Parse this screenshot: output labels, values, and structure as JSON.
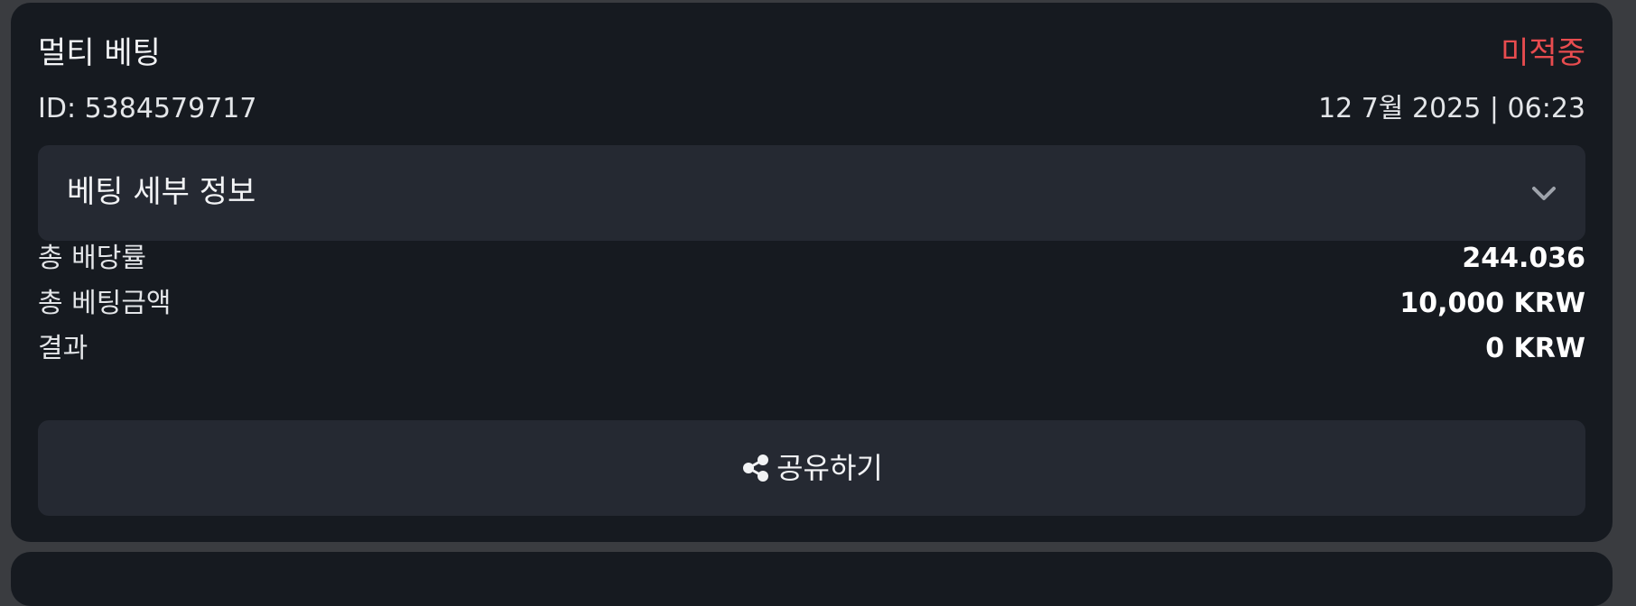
{
  "bet": {
    "title": "멀티 베팅",
    "status": "미적중",
    "id_text": "ID: 5384579717",
    "datetime": "12 7월 2025 | 06:23"
  },
  "details": {
    "label": "베팅 세부 정보"
  },
  "summary": {
    "rows": [
      {
        "label": "총 배당률",
        "value": "244.036"
      },
      {
        "label": "총 베팅금액",
        "value": "10,000 KRW"
      },
      {
        "label": "결과",
        "value": "0 KRW"
      }
    ]
  },
  "share": {
    "label": "공유하기"
  },
  "colors": {
    "card_bg": "#161a20",
    "panel_bg": "#252932",
    "status_red": "#e84c4f"
  },
  "icons": {
    "chevron": "chevron-down-icon",
    "share": "share-icon"
  }
}
